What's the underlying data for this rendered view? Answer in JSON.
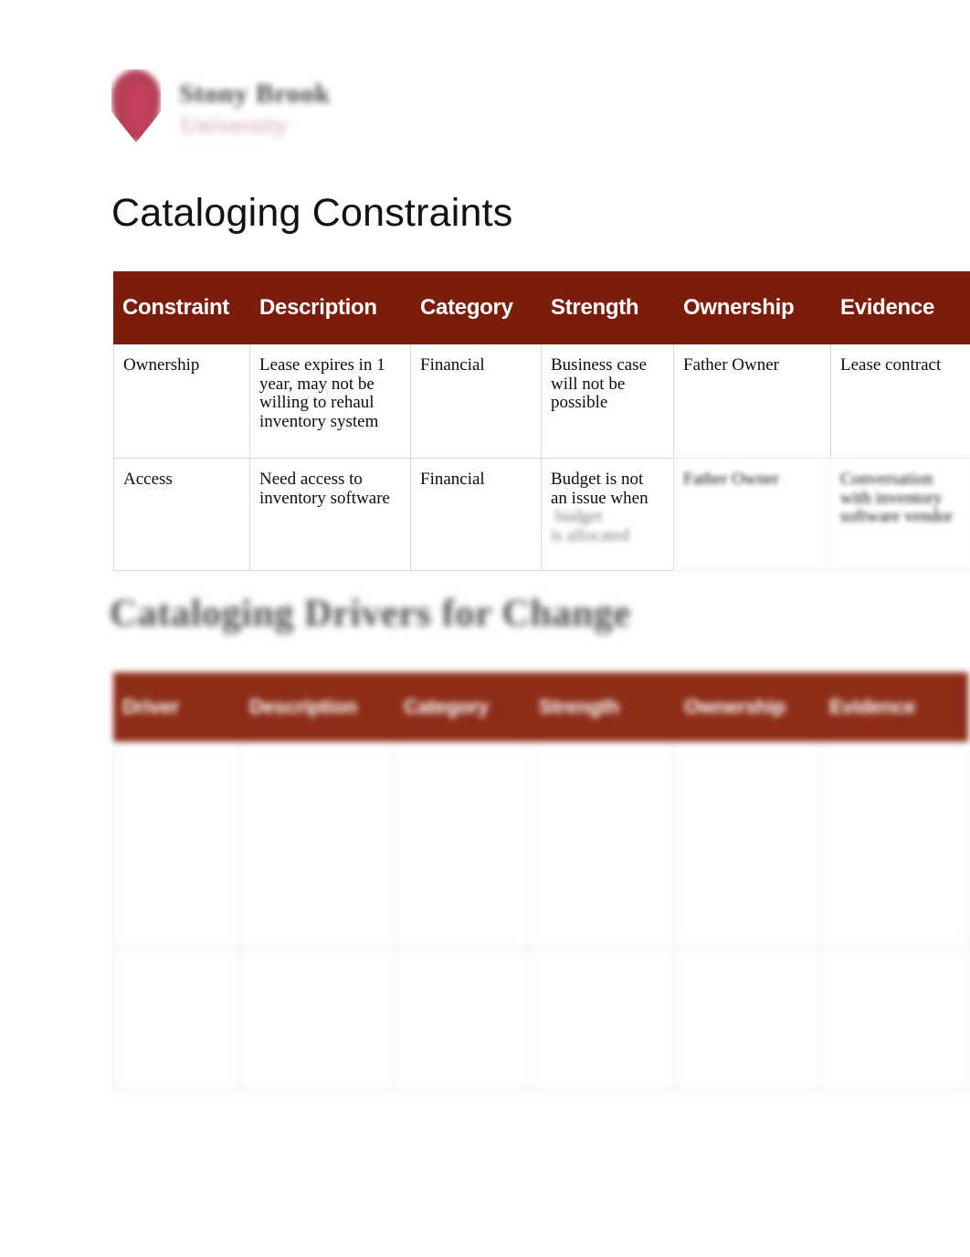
{
  "document": {
    "logo": {
      "icon": "shield-icon",
      "wordmark": "Stony Brook",
      "sub_wordmark": "University"
    },
    "headings": {
      "primary": "Cataloging Constraints",
      "secondary": "Cataloging Drivers for Change"
    }
  },
  "constraints_table": {
    "name": "cataloging-constraints-table",
    "header_color": "#7c1c0b",
    "columns": [
      "Constraint",
      "Description",
      "Category",
      "Strength",
      "Ownership",
      "Evidence"
    ],
    "rows": [
      {
        "constraint": "Ownership",
        "description": "Lease expires in 1 year, may not be willing to rehaul inventory system",
        "category": "Financial",
        "strength": "Business case will not be possible",
        "ownership": "Father Owner",
        "evidence": "Lease contract"
      },
      {
        "constraint": "Access",
        "description": "Need access to inventory software",
        "category": "Financial",
        "strength": "Budget is not an issue when",
        "ownership": "",
        "evidence": ""
      }
    ]
  },
  "drivers_table": {
    "name": "cataloging-drivers-table",
    "header_color": "#8d2d18",
    "columns": [
      "Driver",
      "Description",
      "Category",
      "Strength",
      "Ownership",
      "Evidence"
    ],
    "rows": [
      {
        "driver": "",
        "description": "",
        "category": "",
        "strength": "",
        "ownership": "",
        "evidence": ""
      },
      {
        "driver": "",
        "description": "",
        "category": "",
        "strength": "",
        "ownership": "",
        "evidence": ""
      }
    ]
  }
}
